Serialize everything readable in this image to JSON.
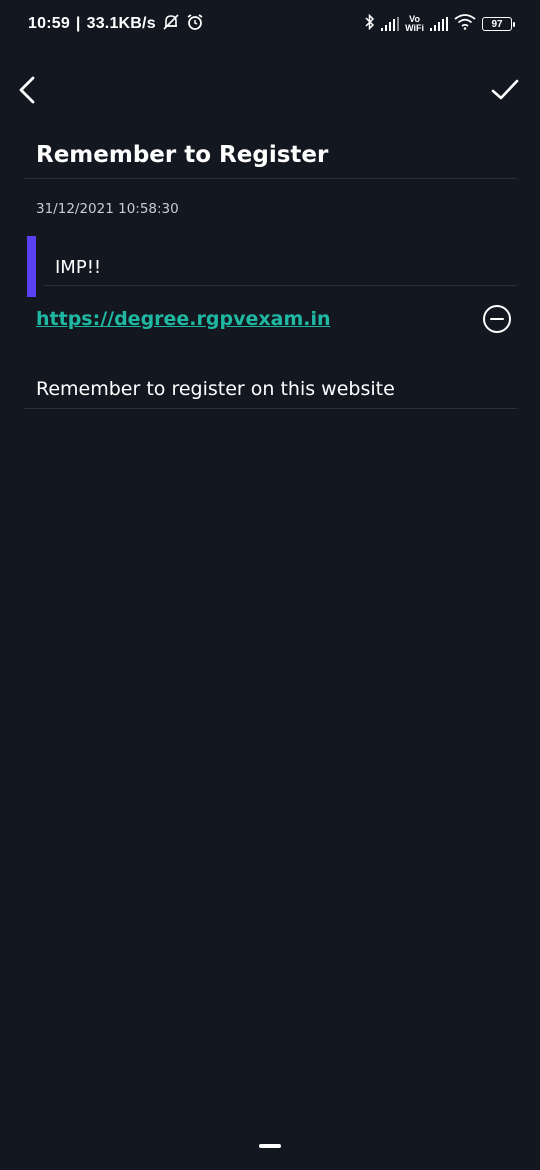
{
  "status_bar": {
    "time": "10:59",
    "separator": "|",
    "speed": "33.1KB/s",
    "vowifi_top": "Vo",
    "vowifi_bottom": "WiFi",
    "battery": "97"
  },
  "toolbar": {
    "back_icon": "chevron-left-icon",
    "save_icon": "checkmark-icon"
  },
  "note": {
    "title": "Remember to Register",
    "timestamp": "31/12/2021 10:58:30",
    "quote": "IMP!!",
    "link": "https://degree.rgpvexam.in",
    "body": "Remember to register on this website"
  },
  "colors": {
    "background": "#131720",
    "accent": "#5b3ff2",
    "link": "#1fb8a2"
  }
}
